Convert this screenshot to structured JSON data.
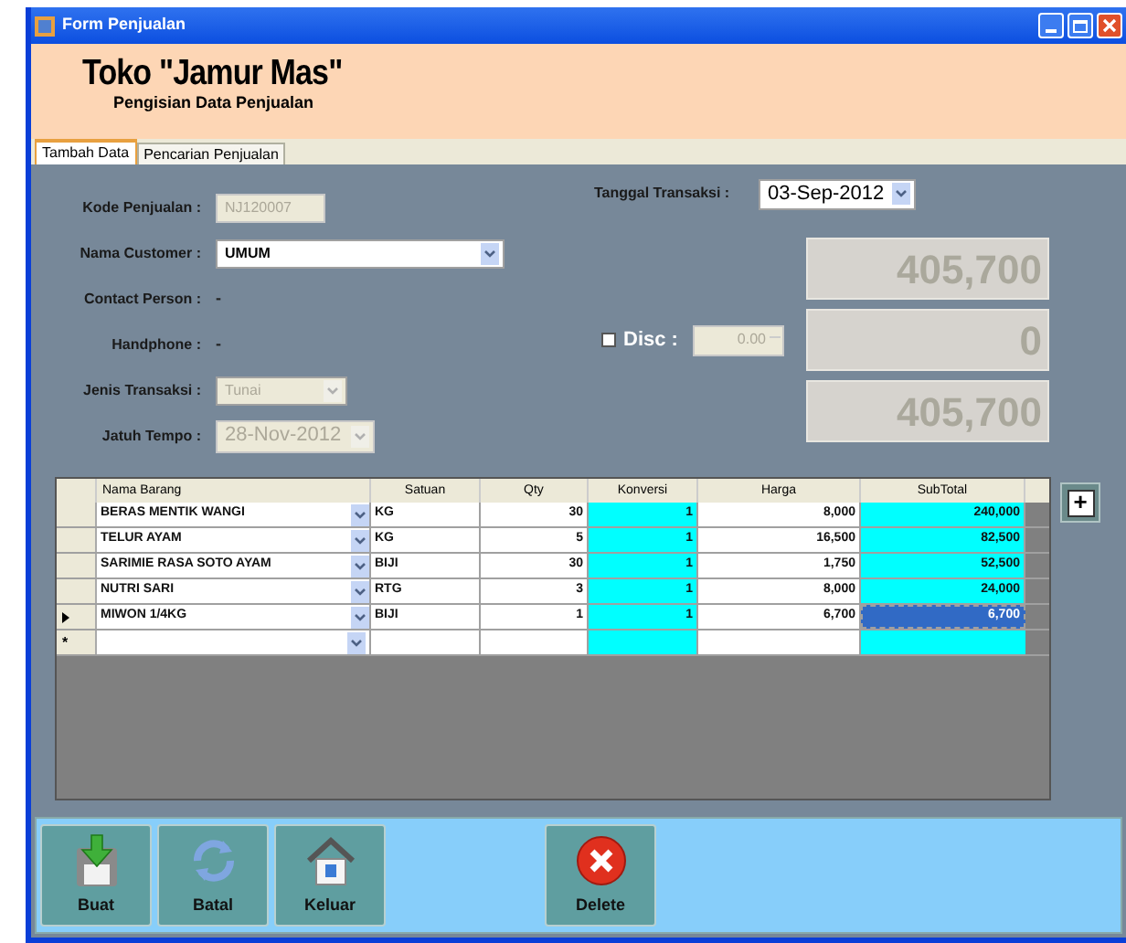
{
  "window": {
    "title": "Form Penjualan"
  },
  "header": {
    "title": "Toko \"Jamur Mas\"",
    "subtitle": "Pengisian Data Penjualan"
  },
  "tabs": [
    {
      "label": "Tambah Data",
      "selected": true
    },
    {
      "label": "Pencarian Penjualan",
      "selected": false
    }
  ],
  "form_left": [
    {
      "label": "Kode Penjualan :",
      "kind": "text",
      "value": "NJ120007",
      "disabled": true
    },
    {
      "label": "Nama Customer :",
      "kind": "combo",
      "value": "UMUM",
      "disabled": false
    },
    {
      "label": "Contact Person :",
      "kind": "plain",
      "value": "-"
    },
    {
      "label": "Handphone :",
      "kind": "plain",
      "value": "-"
    },
    {
      "label": "Jenis Transaksi :",
      "kind": "combo",
      "value": "Tunai",
      "disabled": true
    },
    {
      "label": "Jatuh Tempo :",
      "kind": "date",
      "value": "28-Nov-2012",
      "disabled": true
    }
  ],
  "tanggal": {
    "label": "Tanggal Transaksi :",
    "value": "03-Sep-2012"
  },
  "disc": {
    "label": "Disc :",
    "checked": false,
    "value": "0.00"
  },
  "totals": [
    "405,700",
    "0",
    "405,700"
  ],
  "grid": {
    "columns": [
      "Nama Barang",
      "Satuan",
      "Qty",
      "Konversi",
      "Harga",
      "SubTotal"
    ],
    "rows": [
      {
        "nama": "BERAS MENTIK WANGI",
        "satuan": "KG",
        "qty": "30",
        "konversi": "1",
        "harga": "8,000",
        "subtotal": "240,000",
        "selected": false
      },
      {
        "nama": "TELUR AYAM",
        "satuan": "KG",
        "qty": "5",
        "konversi": "1",
        "harga": "16,500",
        "subtotal": "82,500",
        "selected": false
      },
      {
        "nama": "SARIMIE RASA SOTO AYAM",
        "satuan": "BIJI",
        "qty": "30",
        "konversi": "1",
        "harga": "1,750",
        "subtotal": "52,500",
        "selected": false
      },
      {
        "nama": "NUTRI SARI",
        "satuan": "RTG",
        "qty": "3",
        "konversi": "1",
        "harga": "8,000",
        "subtotal": "24,000",
        "selected": false
      },
      {
        "nama": "MIWON 1/4KG",
        "satuan": "BIJI",
        "qty": "1",
        "konversi": "1",
        "harga": "6,700",
        "subtotal": "6,700",
        "selected": true
      }
    ],
    "new_row_marker": "*"
  },
  "add_button": {
    "label": "+"
  },
  "buttons": [
    {
      "label": "Buat",
      "kind": "save"
    },
    {
      "label": "Batal",
      "kind": "refresh"
    },
    {
      "label": "Keluar",
      "kind": "home"
    },
    {
      "label": "Delete",
      "kind": "delete"
    }
  ]
}
